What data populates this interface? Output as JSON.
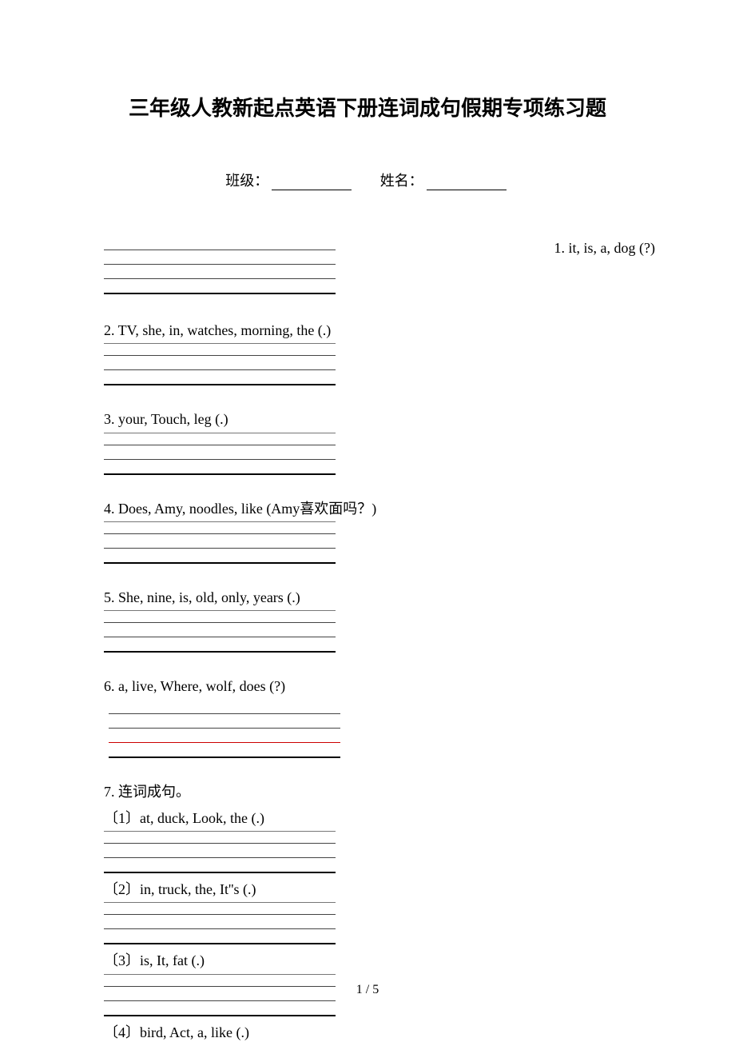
{
  "title": "三年级人教新起点英语下册连词成句假期专项练习题",
  "class_label": "班级：",
  "name_label": "姓名：",
  "q1": "1. it, is, a, dog (?)",
  "q2": "2. TV, she, in, watches, morning, the (.)",
  "q3": "3. your, Touch, leg (.)",
  "q4": "4. Does, Amy, noodles, like (Amy喜欢面吗？)",
  "q5": "5. She, nine, is, old, only, years (.)",
  "q6": "6. a, live, Where, wolf, does (?)",
  "q7": "7. 连词成句。",
  "q7_1": "〔1〕at, duck, Look, the (.)",
  "q7_2": "〔2〕in, truck, the, It''s (.)",
  "q7_3": "〔3〕is, It, fat (.)",
  "q7_4": "〔4〕bird, Act, a, like (.)",
  "page_number": "1 / 5"
}
